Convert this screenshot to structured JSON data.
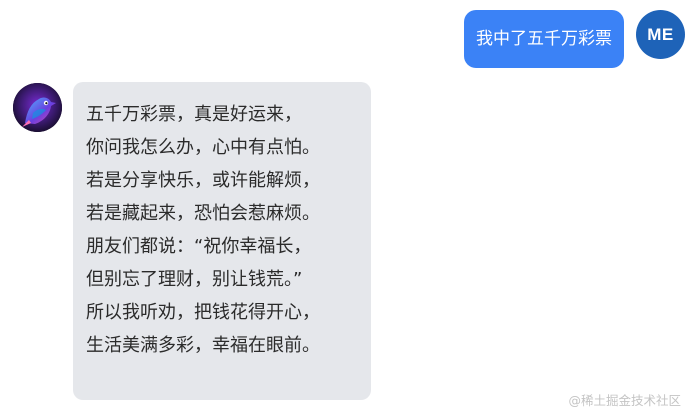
{
  "user_message": {
    "avatar_label": "ME",
    "text": "我中了五千万彩票"
  },
  "bot_message": {
    "avatar_icon": "bird-avatar-icon",
    "lines": [
      "五千万彩票，真是好运来，",
      "你问我怎么办，心中有点怕。",
      "若是分享快乐，或许能解烦，",
      "若是藏起来，恐怕会惹麻烦。",
      "朋友们都说：“祝你幸福长，",
      "但别忘了理财，别让钱荒。”",
      "所以我听劝，把钱花得开心，",
      "生活美满多彩，幸福在眼前。"
    ]
  },
  "watermark": "@稀土掘金技术社区",
  "colors": {
    "user_bubble": "#3b82f6",
    "me_avatar": "#1e63b8",
    "bot_bubble": "#e5e7eb"
  }
}
